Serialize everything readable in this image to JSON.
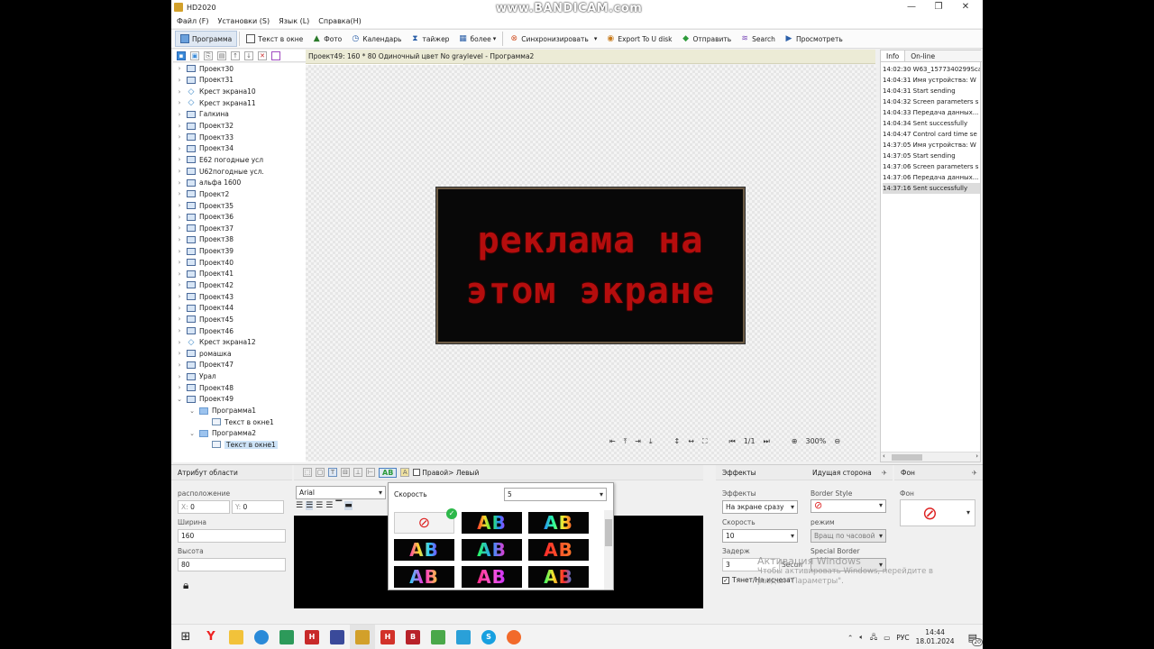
{
  "window": {
    "title": "HD2020",
    "recorder_watermark": "www.BANDICAM.com"
  },
  "menu": [
    "Файл (F)",
    "Установки (S)",
    "Язык (L)",
    "Справка(H)"
  ],
  "toolbar": {
    "program": "Программа",
    "text_window": "Текст в окне",
    "photo": "Фото",
    "calendar": "Календарь",
    "timer": "тайжер",
    "more": "более",
    "sync": "Синхронизировать",
    "export_udisk": "Export To U disk",
    "send": "Отправить",
    "search": "Search",
    "preview": "Просмотреть"
  },
  "tree": {
    "items": [
      {
        "label": "Проект30",
        "icon": "screen-icon",
        "expander": ">",
        "indent": 0
      },
      {
        "label": "Проект31",
        "icon": "screen-icon",
        "expander": ">",
        "indent": 0
      },
      {
        "label": "Крест экрана10",
        "icon": "diamond-icon",
        "expander": ">",
        "indent": 0
      },
      {
        "label": "Крест экрана11",
        "icon": "diamond-icon",
        "expander": ">",
        "indent": 0
      },
      {
        "label": "Галкина",
        "icon": "screen-icon",
        "expander": ">",
        "indent": 0
      },
      {
        "label": "Проект32",
        "icon": "screen-icon",
        "expander": ">",
        "indent": 0
      },
      {
        "label": "Проект33",
        "icon": "screen-icon",
        "expander": ">",
        "indent": 0
      },
      {
        "label": "Проект34",
        "icon": "screen-icon",
        "expander": ">",
        "indent": 0
      },
      {
        "label": "Е62 погодные усл",
        "icon": "screen-icon",
        "expander": ">",
        "indent": 0
      },
      {
        "label": "U62погодные усл.",
        "icon": "screen-icon",
        "expander": ">",
        "indent": 0
      },
      {
        "label": "альфа 1600",
        "icon": "screen-icon",
        "expander": ">",
        "indent": 0
      },
      {
        "label": "Проект2",
        "icon": "screen-icon",
        "expander": ">",
        "indent": 0
      },
      {
        "label": "Проект35",
        "icon": "screen-icon",
        "expander": ">",
        "indent": 0
      },
      {
        "label": "Проект36",
        "icon": "screen-icon",
        "expander": ">",
        "indent": 0
      },
      {
        "label": "Проект37",
        "icon": "screen-icon",
        "expander": ">",
        "indent": 0
      },
      {
        "label": "Проект38",
        "icon": "screen-icon",
        "expander": ">",
        "indent": 0
      },
      {
        "label": "Проект39",
        "icon": "screen-icon",
        "expander": ">",
        "indent": 0
      },
      {
        "label": "Проект40",
        "icon": "screen-icon",
        "expander": ">",
        "indent": 0
      },
      {
        "label": "Проект41",
        "icon": "screen-icon",
        "expander": ">",
        "indent": 0
      },
      {
        "label": "Проект42",
        "icon": "screen-icon",
        "expander": ">",
        "indent": 0
      },
      {
        "label": "Проект43",
        "icon": "screen-icon",
        "expander": ">",
        "indent": 0
      },
      {
        "label": "Проект44",
        "icon": "screen-icon",
        "expander": ">",
        "indent": 0
      },
      {
        "label": "Проект45",
        "icon": "screen-icon",
        "expander": ">",
        "indent": 0
      },
      {
        "label": "Проект46",
        "icon": "screen-icon",
        "expander": ">",
        "indent": 0
      },
      {
        "label": "Крест экрана12",
        "icon": "diamond-icon",
        "expander": ">",
        "indent": 0
      },
      {
        "label": "ромашка",
        "icon": "screen-icon",
        "expander": ">",
        "indent": 0
      },
      {
        "label": "Проект47",
        "icon": "screen-icon",
        "expander": ">",
        "indent": 0
      },
      {
        "label": "Урал",
        "icon": "screen-icon",
        "expander": ">",
        "indent": 0
      },
      {
        "label": "Проект48",
        "icon": "screen-icon",
        "expander": ">",
        "indent": 0
      },
      {
        "label": "Проект49",
        "icon": "screen-icon",
        "expander": "v",
        "indent": 0
      },
      {
        "label": "Программа1",
        "icon": "program-icon",
        "expander": "v",
        "indent": 1
      },
      {
        "label": "Текст в окне1",
        "icon": "text-window-icon",
        "expander": "",
        "indent": 2
      },
      {
        "label": "Программа2",
        "icon": "program-icon",
        "expander": "v",
        "indent": 1
      },
      {
        "label": "Текст в окне1",
        "icon": "text-window-icon",
        "expander": "",
        "indent": 2,
        "selected": true
      }
    ]
  },
  "canvas": {
    "header": "Проект49: 160 * 80 Одиночный цвет No graylevel - Программа2",
    "led_lines": [
      "реклама на",
      "этом экране"
    ],
    "led_text_color": "#b50d0d",
    "page": "1/1",
    "zoom": "300%"
  },
  "info": {
    "tabs": [
      "Info",
      "On-line"
    ],
    "log": [
      "14:02:30 W63_1577340299Sca",
      "14:04:31 Имя устройства: W",
      "14:04:31 Start sending",
      "14:04:32 Screen parameters s",
      "14:04:33 Передача данных...",
      "14:04:34 Sent successfully",
      "14:04:47 Control card time se",
      "14:37:05 Имя устройства: W",
      "14:37:05 Start sending",
      "14:37:06 Screen parameters s",
      "14:37:06 Передача данных...",
      "14:37:16 Sent successfully"
    ],
    "selected_index": 11
  },
  "area_attr": {
    "title": "Атрибут области",
    "position_label": "расположение",
    "x_label": "X:",
    "x_value": "0",
    "y_label": "Y:",
    "y_value": "0",
    "width_label": "Ширина",
    "width_value": "160",
    "height_label": "Высота",
    "height_value": "80"
  },
  "text_props": {
    "font": "Arial",
    "ab_label": "AB",
    "direction_label": "Правой> Левый"
  },
  "effect_popup": {
    "speed_label": "Скорость",
    "speed_value": "5",
    "tiles": [
      "AB",
      "AB",
      "AB",
      "AB",
      "AB",
      "AB",
      "AB",
      "AB"
    ]
  },
  "effects": {
    "title": "Эффекты",
    "effects_label": "Эффекты",
    "effects_value": "На экране сразу",
    "speed_label": "Скорость",
    "speed_value": "10",
    "delay_label": "Задерж",
    "delay_value": "3",
    "delay_unit": "Secun",
    "drag_label": "Тянет/На исчезат"
  },
  "border": {
    "title": "Идущая сторона",
    "style_label": "Border Style",
    "mode_label": "режим",
    "mode_value": "Вращ по часовой",
    "special_label": "Special Border"
  },
  "background": {
    "title": "Фон",
    "label": "Фон"
  },
  "activation": {
    "title": "Активация Windows",
    "line1": "Чтобы активировать Windows, перейдите в",
    "line2": "раздел \"Параметры\"."
  },
  "taskbar": {
    "language": "РУС",
    "time": "14:44",
    "date": "18.01.2024",
    "notifications": "20"
  }
}
